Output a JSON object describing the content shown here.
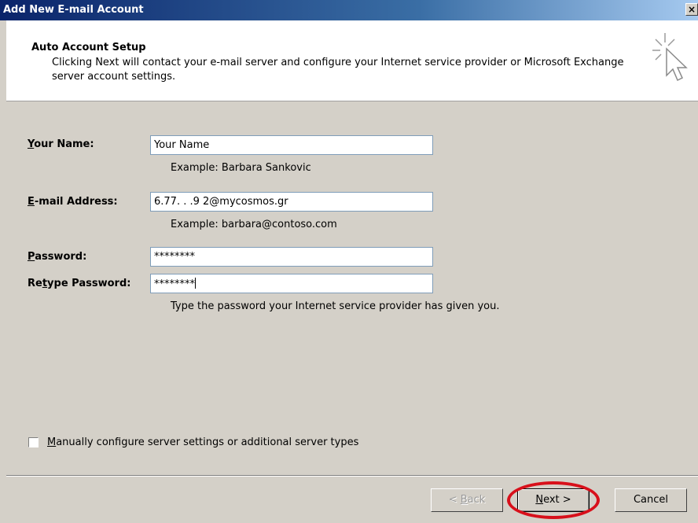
{
  "window": {
    "title": "Add New E-mail Account",
    "close_glyph": "×"
  },
  "header": {
    "title": "Auto Account Setup",
    "description": "Clicking Next will contact your e-mail server and configure your Internet service provider or Microsoft Exchange server account settings.",
    "icon": "cursor-wand-icon"
  },
  "form": {
    "name_label_prefix": "",
    "name_label_accel": "Y",
    "name_label_rest": "our Name:",
    "name_value": "Your Name",
    "name_hint": "Example: Barbara Sankovic",
    "email_label_accel": "E",
    "email_label_rest": "-mail Address:",
    "email_value": "6.77. . .9 2@mycosmos.gr",
    "email_hint": "Example: barbara@contoso.com",
    "password_label_accel": "P",
    "password_label_rest": "assword:",
    "password_value": "********",
    "retype_label_prefix": "Re",
    "retype_label_accel": "t",
    "retype_label_rest": "ype Password:",
    "retype_value": "********",
    "password_hint": "Type the password your Internet service provider has given you."
  },
  "manual_config": {
    "checked": false,
    "label_accel": "M",
    "label_rest": "anually configure server settings or additional server types"
  },
  "buttons": {
    "back_prefix": "< ",
    "back_accel": "B",
    "back_rest": "ack",
    "next_accel": "N",
    "next_rest": "ext >",
    "cancel": "Cancel"
  },
  "colors": {
    "annotation_ring": "#d8101b",
    "title_bar": "#0a246a"
  }
}
